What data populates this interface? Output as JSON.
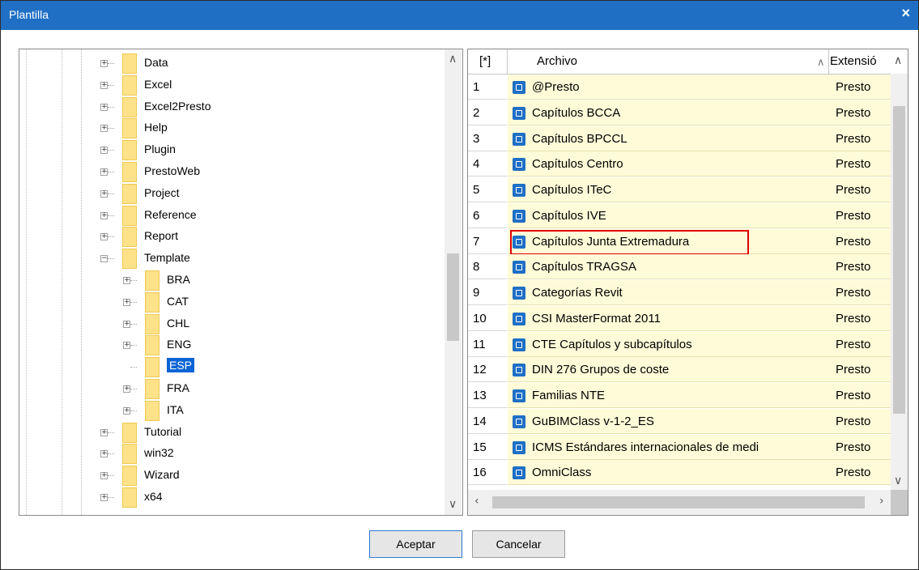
{
  "window": {
    "title": "Plantilla",
    "close_label": "×"
  },
  "tree": {
    "items": [
      {
        "label": "Data",
        "level": 1,
        "expander": "+"
      },
      {
        "label": "Excel",
        "level": 1,
        "expander": "+"
      },
      {
        "label": "Excel2Presto",
        "level": 1,
        "expander": "+"
      },
      {
        "label": "Help",
        "level": 1,
        "expander": "+"
      },
      {
        "label": "Plugin",
        "level": 1,
        "expander": "+"
      },
      {
        "label": "PrestoWeb",
        "level": 1,
        "expander": "+"
      },
      {
        "label": "Project",
        "level": 1,
        "expander": "+"
      },
      {
        "label": "Reference",
        "level": 1,
        "expander": "+"
      },
      {
        "label": "Report",
        "level": 1,
        "expander": "+"
      },
      {
        "label": "Template",
        "level": 1,
        "expander": "−"
      },
      {
        "label": "BRA",
        "level": 2,
        "expander": "+"
      },
      {
        "label": "CAT",
        "level": 2,
        "expander": "+"
      },
      {
        "label": "CHL",
        "level": 2,
        "expander": "+"
      },
      {
        "label": "ENG",
        "level": 2,
        "expander": "+"
      },
      {
        "label": "ESP",
        "level": 2,
        "expander": "",
        "selected": true
      },
      {
        "label": "FRA",
        "level": 2,
        "expander": "+"
      },
      {
        "label": "ITA",
        "level": 2,
        "expander": "+"
      },
      {
        "label": "Tutorial",
        "level": 1,
        "expander": "+"
      },
      {
        "label": "win32",
        "level": 1,
        "expander": "+"
      },
      {
        "label": "Wizard",
        "level": 1,
        "expander": "+"
      },
      {
        "label": "x64",
        "level": 1,
        "expander": "+"
      }
    ]
  },
  "grid": {
    "col_index": "[*]",
    "col_file": "Archivo",
    "col_ext": "Extensió",
    "sort_glyph": "∧",
    "rows": [
      {
        "n": "1",
        "name": "@Presto",
        "ext": "Presto"
      },
      {
        "n": "2",
        "name": "Capítulos BCCA",
        "ext": "Presto"
      },
      {
        "n": "3",
        "name": "Capítulos BPCCL",
        "ext": "Presto"
      },
      {
        "n": "4",
        "name": "Capítulos Centro",
        "ext": "Presto"
      },
      {
        "n": "5",
        "name": "Capítulos ITeC",
        "ext": "Presto"
      },
      {
        "n": "6",
        "name": "Capítulos IVE",
        "ext": "Presto"
      },
      {
        "n": "7",
        "name": "Capítulos Junta Extremadura",
        "ext": "Presto",
        "highlight": true
      },
      {
        "n": "8",
        "name": "Capítulos TRAGSA",
        "ext": "Presto"
      },
      {
        "n": "9",
        "name": "Categorías Revit",
        "ext": "Presto"
      },
      {
        "n": "10",
        "name": "CSI MasterFormat 2011",
        "ext": "Presto"
      },
      {
        "n": "11",
        "name": "CTE Capítulos y subcapítulos",
        "ext": "Presto"
      },
      {
        "n": "12",
        "name": "DIN 276 Grupos de coste",
        "ext": "Presto"
      },
      {
        "n": "13",
        "name": "Familias NTE",
        "ext": "Presto"
      },
      {
        "n": "14",
        "name": "GuBIMClass v-1-2_ES",
        "ext": "Presto"
      },
      {
        "n": "15",
        "name": "ICMS Estándares internacionales de medi",
        "ext": "Presto"
      },
      {
        "n": "16",
        "name": "OmniClass",
        "ext": "Presto"
      }
    ]
  },
  "buttons": {
    "ok": "Aceptar",
    "cancel": "Cancelar"
  },
  "colors": {
    "titlebar": "#1f6fc5",
    "selection": "#0a64d6",
    "row_bg": "#fffbd8",
    "highlight_box": "#e00000"
  }
}
